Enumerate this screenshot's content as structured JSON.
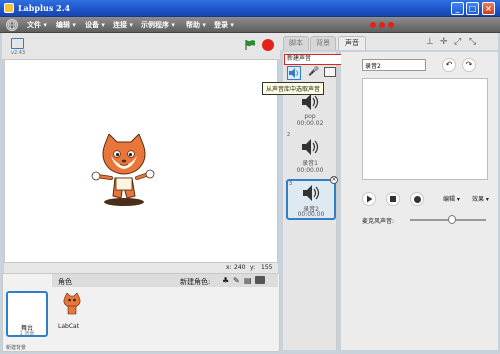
{
  "window": {
    "title": "Labplus 2.4",
    "minimize": "_",
    "maximize": "□",
    "close": "×"
  },
  "menu": {
    "items": [
      "文件 ▾",
      "编辑 ▾",
      "设备 ▾",
      "连接 ▾",
      "示例程序 ▾",
      "帮助 ▾",
      "登录 ▾"
    ]
  },
  "stage": {
    "version": "v2.43",
    "coords_x_label": "x:",
    "coords_x": "240",
    "coords_y_label": "y:",
    "coords_y": "155"
  },
  "sprites": {
    "header_label": "角色",
    "new_sprite_label": "新建角色:",
    "stage_thumb_label": "舞台",
    "stage_thumb_sub": "1 背景",
    "new_backdrop_label": "新建背景",
    "sprite_name": "LabCat"
  },
  "tabs": {
    "script": "脚本",
    "backdrop": "背景",
    "sound": "声音"
  },
  "sounds": {
    "new_sound_label": "新建声音",
    "tooltip": "从声音库中选取声音",
    "items": [
      {
        "index": "",
        "name": "pop",
        "duration": "00:00.02"
      },
      {
        "index": "2",
        "name": "录音1",
        "duration": "00:00.00"
      },
      {
        "index": "3",
        "name": "录音2",
        "duration": "00:00.00"
      }
    ]
  },
  "editor": {
    "name_value": "录音2",
    "edit_menu": "编辑 ▾",
    "effects_menu": "效果 ▾",
    "mic_volume_label": "麦克风声音:",
    "mic_volume_level": 0.55
  },
  "colors": {
    "accent_blue": "#2f7fc8",
    "record_red": "#e2231a",
    "flag_green": "#2e8b2e",
    "cat_orange": "#e8763a"
  }
}
